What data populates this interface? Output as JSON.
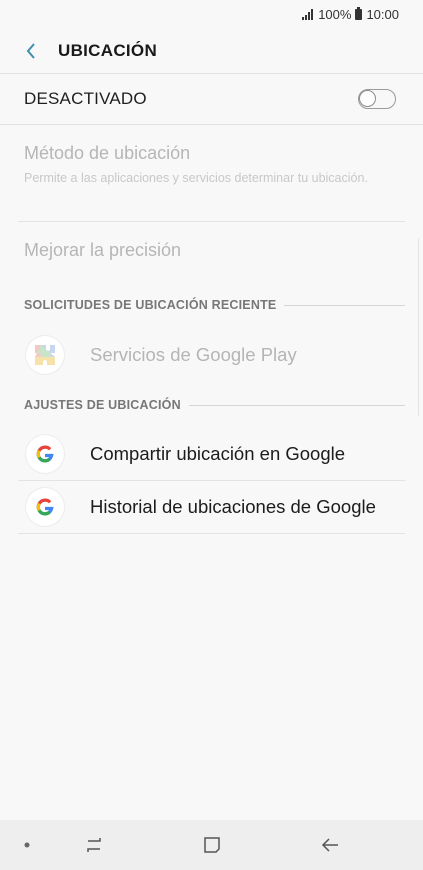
{
  "status_bar": {
    "battery": "100%",
    "time": "10:00"
  },
  "header": {
    "title": "UBICACIÓN"
  },
  "master_toggle": {
    "label": "DESACTIVADO",
    "state": "off"
  },
  "settings": {
    "location_method": {
      "title": "Método de ubicación",
      "subtitle": "Permite a las aplicaciones y servicios determinar tu ubicación."
    },
    "improve_accuracy": {
      "title": "Mejorar la precisión"
    }
  },
  "recent_requests": {
    "header": "SOLICITUDES DE UBICACIÓN RECIENTE",
    "items": [
      {
        "label": "Servicios de Google Play",
        "icon": "google-play-services-icon"
      }
    ]
  },
  "location_settings": {
    "header": "AJUSTES DE UBICACIÓN",
    "items": [
      {
        "label": "Compartir ubicación en Google",
        "icon": "google-icon"
      },
      {
        "label": "Historial de ubicaciones de Google",
        "icon": "google-icon"
      }
    ]
  },
  "colors": {
    "accent": "#3e8fb0",
    "disabled_text": "#b6b6b6",
    "nav_bar": "#eeeeee"
  }
}
